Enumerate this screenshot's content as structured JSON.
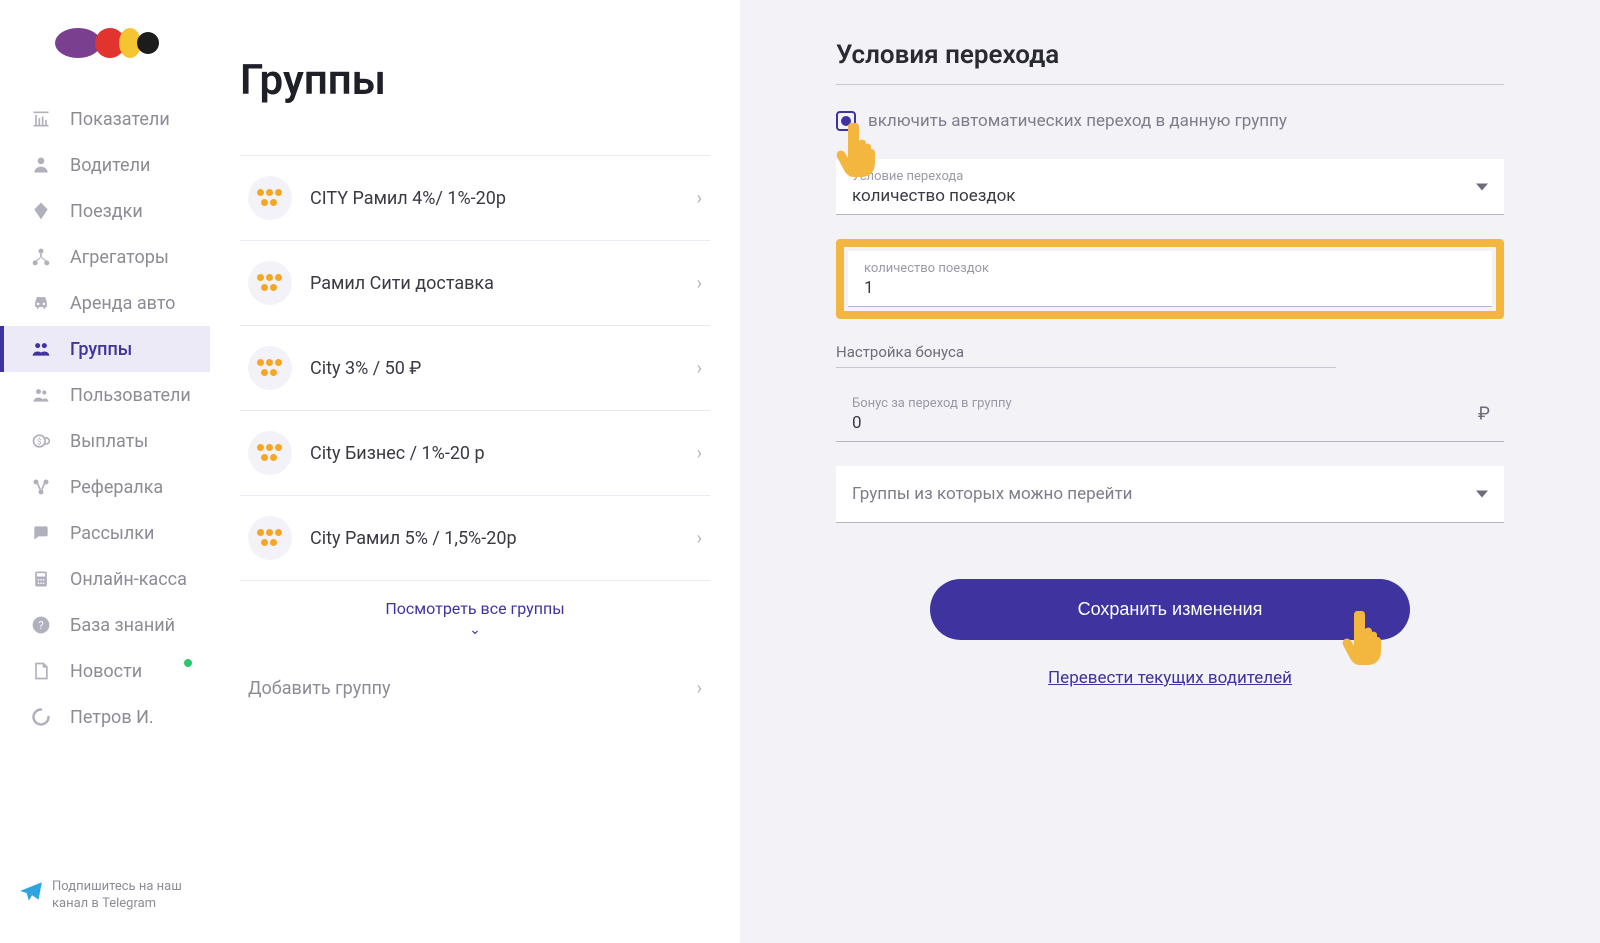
{
  "sidebar": {
    "items": [
      {
        "label": "Показатели",
        "icon": "chart-icon",
        "active": false
      },
      {
        "label": "Водители",
        "icon": "person-icon",
        "active": false
      },
      {
        "label": "Поездки",
        "icon": "diamond-icon",
        "active": false
      },
      {
        "label": "Агрегаторы",
        "icon": "hierarchy-icon",
        "active": false
      },
      {
        "label": "Аренда авто",
        "icon": "car-icon",
        "active": false
      },
      {
        "label": "Группы",
        "icon": "groups-icon",
        "active": true
      },
      {
        "label": "Пользователи",
        "icon": "users-icon",
        "active": false
      },
      {
        "label": "Выплаты",
        "icon": "payout-icon",
        "active": false
      },
      {
        "label": "Рефералка",
        "icon": "referral-icon",
        "active": false
      },
      {
        "label": "Рассылки",
        "icon": "chat-icon",
        "active": false
      },
      {
        "label": "Онлайн-касса",
        "icon": "calculator-icon",
        "active": false
      },
      {
        "label": "База знаний",
        "icon": "help-icon",
        "active": false
      },
      {
        "label": "Новости",
        "icon": "document-icon",
        "active": false,
        "dot": true
      }
    ],
    "user": {
      "label": "Петров И.",
      "icon": "spinner-icon"
    },
    "telegram": "Подпишитесь на наш канал в Telegram"
  },
  "mid": {
    "title": "Группы",
    "groups": [
      "CITY Рамил 4%/ 1%-20р",
      "Рамил Сити доставка",
      "City 3% / 50 ₽",
      "City Бизнес / 1%-20 р",
      "City Рамил 5% / 1,5%-20р"
    ],
    "see_all": "Посмотреть все группы",
    "add_group": "Добавить группу"
  },
  "right": {
    "title": "Условия перехода",
    "enable_label": "включить автоматических переход в данную группу",
    "condition_field": {
      "label": "Условие перехода",
      "value": "количество поездок"
    },
    "rides_field": {
      "label": "количество поездок",
      "value": "1"
    },
    "bonus_section": "Настройка бонуса",
    "bonus_field": {
      "label": "Бонус за переход в группу",
      "value": "0",
      "suffix": "₽"
    },
    "source_groups_placeholder": "Группы из которых можно перейти",
    "save_button": "Сохранить изменения",
    "transfer_link": "Перевести текущих водителей"
  }
}
